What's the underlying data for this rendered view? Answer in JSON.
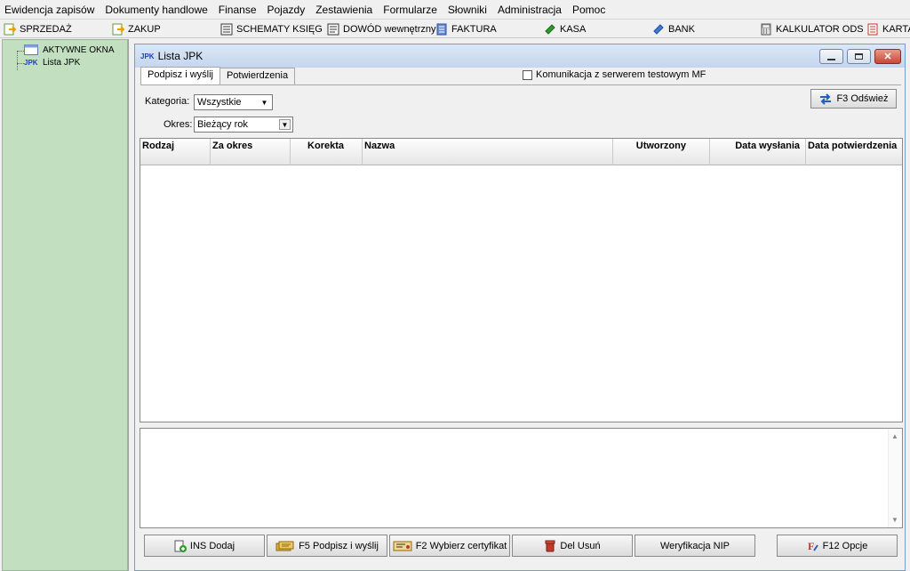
{
  "menu": [
    "Ewidencja zapisów",
    "Dokumenty handlowe",
    "Finanse",
    "Pojazdy",
    "Zestawienia",
    "Formularze",
    "Słowniki",
    "Administracja",
    "Pomoc"
  ],
  "toolbar": {
    "sprzedaz": "SPRZEDAŻ",
    "zakup": "ZAKUP",
    "schematy": "SCHEMATY KSIĘG",
    "dowod": "DOWÓD wewnętrzny",
    "faktura": "FAKTURA",
    "kasa": "KASA",
    "bank": "BANK",
    "kalkulator": "KALKULATOR ODS",
    "karta": "KARTA"
  },
  "tree": {
    "root": "AKTYWNE OKNA",
    "child_icon": "JPK",
    "child": "Lista JPK"
  },
  "window": {
    "icon": "JPK",
    "title": "Lista JPK"
  },
  "tabs": [
    "Podpisz i wyślij",
    "Potwierdzenia"
  ],
  "mf_checkbox": "Komunikacja z serwerem testowym MF",
  "filters": {
    "kategoria_label": "Kategoria:",
    "kategoria_value": "Wszystkie",
    "okres_label": "Okres:",
    "okres_value": "Bieżący rok"
  },
  "refresh_button": "F3 Odśwież",
  "grid_columns": [
    "Rodzaj",
    "Za okres",
    "Korekta",
    "Nazwa",
    "Utworzony",
    "Data wysłania",
    "Data potwierdzenia"
  ],
  "buttons": {
    "dodaj": "INS Dodaj",
    "podpisz": "F5 Podpisz i wyślij",
    "certyfikat": "F2 Wybierz certyfikat",
    "usun": "Del Usuń",
    "nip": "Weryfikacja NIP",
    "opcje": "F12 Opcje"
  },
  "colors": {
    "left_pane": "#c2e0c0",
    "title_gradient": "#c4d6ee",
    "close_button": "#c8463a"
  }
}
